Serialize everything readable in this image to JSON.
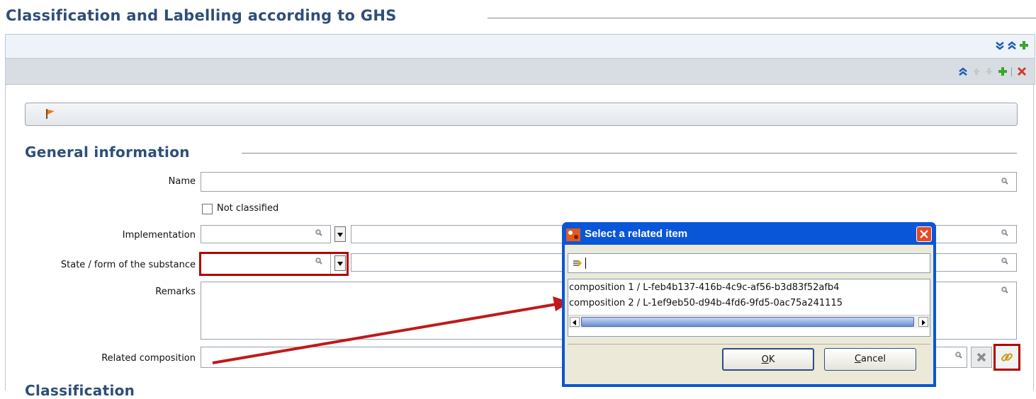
{
  "page": {
    "title": "Classification and Labelling according to GHS"
  },
  "general": {
    "title": "General information",
    "name_label": "Name",
    "name_value": "",
    "not_classified_label": "Not classified",
    "implementation_label": "Implementation",
    "implementation_value": "",
    "state_label": "State / form of the substance",
    "state_value": "",
    "remarks_label": "Remarks",
    "remarks_value": "",
    "related_composition_label": "Related composition",
    "related_composition_value": ""
  },
  "next_section": {
    "title": "Classification"
  },
  "dialog": {
    "title": "Select a related item",
    "filter_value": "",
    "items": [
      "composition 1 / L-feb4b137-416b-4c9c-af56-b3d83f52afb4",
      "composition 2 / L-1ef9eb50-d94b-4fd6-9fd5-0ac75a241115"
    ],
    "ok_label": "OK",
    "ok_mnemonic": "O",
    "ok_rest": "K",
    "cancel_label": "Cancel",
    "cancel_mnemonic": "C",
    "cancel_rest": "ancel"
  },
  "colors": {
    "section_title": "#2f4e78",
    "highlight_red": "#b30000",
    "dialog_blue": "#0a56d8",
    "arrow_red": "#c0191a"
  },
  "icons": {
    "expand_all": "double-chevron-down-icon",
    "collapse_all": "double-chevron-up-icon",
    "add": "green-plus-icon",
    "move_up": "arrow-up-icon",
    "move_down": "arrow-down-icon",
    "delete": "red-x-icon",
    "flag": "flag-icon",
    "search": "magnifier-icon",
    "link": "link-chain-icon",
    "app": "app-logo-icon",
    "close": "close-icon",
    "filter": "filter-arrow-icon"
  }
}
